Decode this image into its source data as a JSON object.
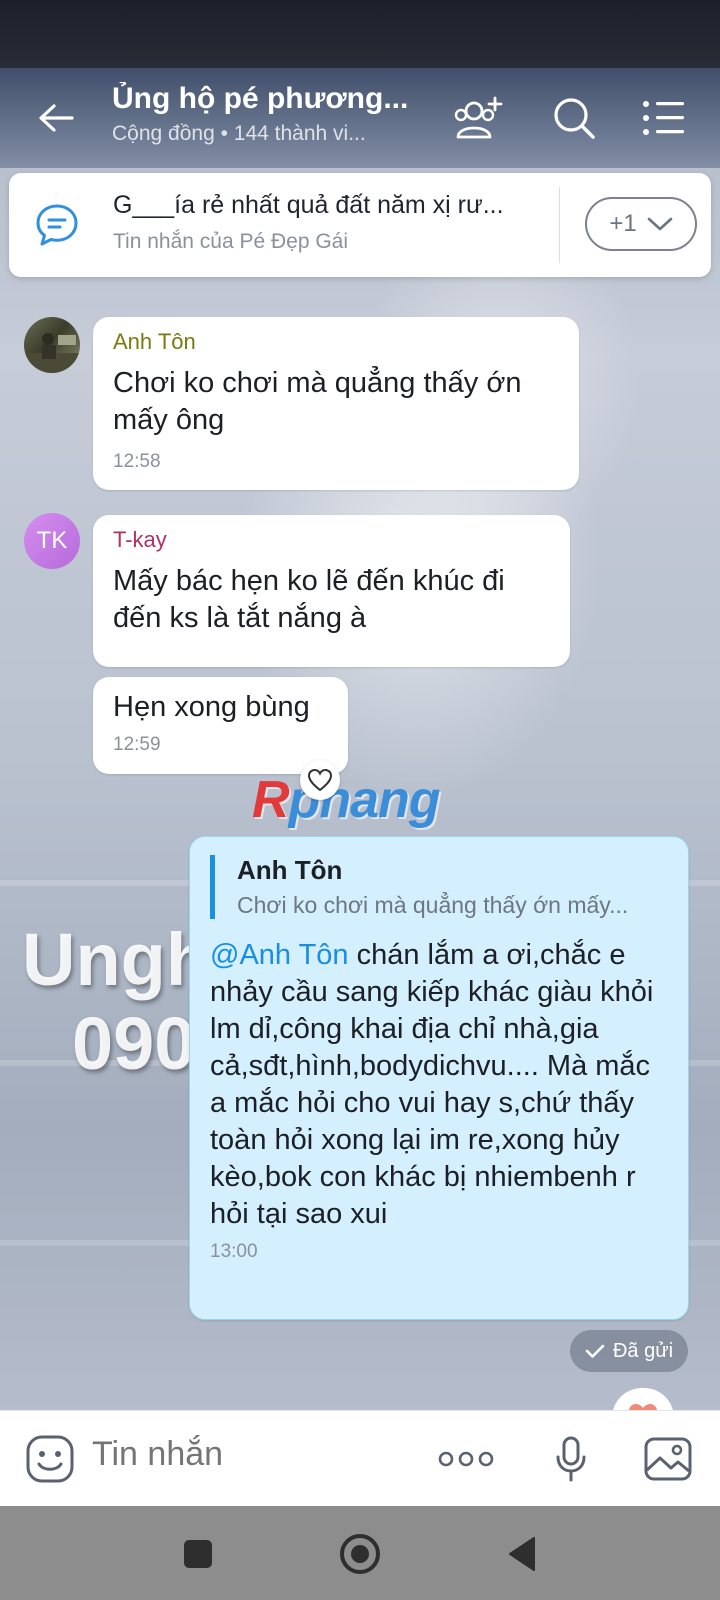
{
  "header": {
    "title": "Ủng hộ pé phương...",
    "subtitle": "Cộng đồng • 144 thành vi..."
  },
  "pinned": {
    "message": "G___ía rẻ nhất quả đất năm xị rư...",
    "from": "Tin nhắn của Pé Đẹp Gái",
    "more_label": "+1"
  },
  "messages": [
    {
      "sender": "Anh Tôn",
      "sender_color": "#7a7a10",
      "text": "Chơi ko chơi mà quẳng thấy ớn mấy ông",
      "time": "12:58"
    },
    {
      "sender": "T-kay",
      "sender_color": "#b0306a",
      "avatar_initials": "TK",
      "text": "Mấy bác hẹn ko lẽ đến khúc đi đến ks là tắt nắng à"
    },
    {
      "text": "Hẹn xong bùng",
      "time": "12:59"
    }
  ],
  "reply": {
    "quote_name": "Anh Tôn",
    "quote_text": "Chơi ko chơi mà quẳng thấy ớn mấy...",
    "mention": "@Anh Tôn",
    "text": " chán lắm a ơi,chắc e nhảy cầu sang kiếp khác giàu khỏi lm dỉ,công khai địa chỉ nhà,gia cả,sđt,hình,bodydichvu.... Mà mắc a mắc hỏi cho vui hay s,chứ thấy toàn hỏi xong lại im re,xong hủy kèo,bok con khác bị nhiembenh r hỏi tại sao xui",
    "time": "13:00"
  },
  "status": {
    "sent_label": "Đã gửi"
  },
  "background": {
    "watermark_r": "R",
    "watermark_rest": "phang",
    "overlay_line1": "Ungh",
    "overlay_line2": "090"
  },
  "input": {
    "placeholder": "Tin nhắn"
  },
  "colors": {
    "accent": "#1a8fe0",
    "reply_bubble": "#d4effd"
  }
}
